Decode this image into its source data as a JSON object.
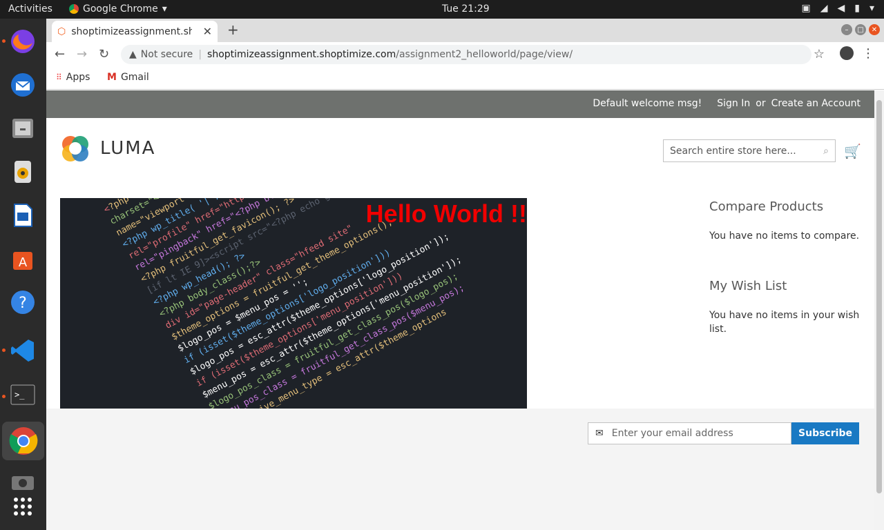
{
  "os": {
    "activities": "Activities",
    "app_menu": "Google Chrome",
    "clock": "Tue 21:29"
  },
  "dock": {
    "items": [
      "firefox-icon",
      "thunderbird-icon",
      "files-icon",
      "rhythmbox-icon",
      "writer-icon",
      "software-icon",
      "help-icon",
      "vscode-icon",
      "terminal-icon",
      "chrome-icon",
      "screenshot-icon",
      "apps-grid-icon"
    ]
  },
  "browser": {
    "tab_title": "shoptimizeassignment.sh",
    "address": {
      "security": "Not secure",
      "host": "shoptimizeassignment.shoptimize.com",
      "path": "/assignment2_helloworld/page/view/"
    },
    "bookmarks": [
      "Apps",
      "Gmail"
    ]
  },
  "site": {
    "header": {
      "welcome": "Default welcome msg!",
      "sign_in": "Sign In",
      "or": "or",
      "create_account": "Create an Account"
    },
    "logo_text": "LUMA",
    "search_placeholder": "Search entire store here...",
    "hero_text": "Hello World !!",
    "compare": {
      "title": "Compare Products",
      "text": "You have no items to compare."
    },
    "wishlist": {
      "title": "My Wish List",
      "text": "You have no items in your wish list."
    },
    "newsletter": {
      "placeholder": "Enter your email address",
      "button": "Subscribe"
    }
  },
  "colors": {
    "header_bar": "#6e716e",
    "subscribe": "#1979c3",
    "hero_text": "#f10000"
  }
}
